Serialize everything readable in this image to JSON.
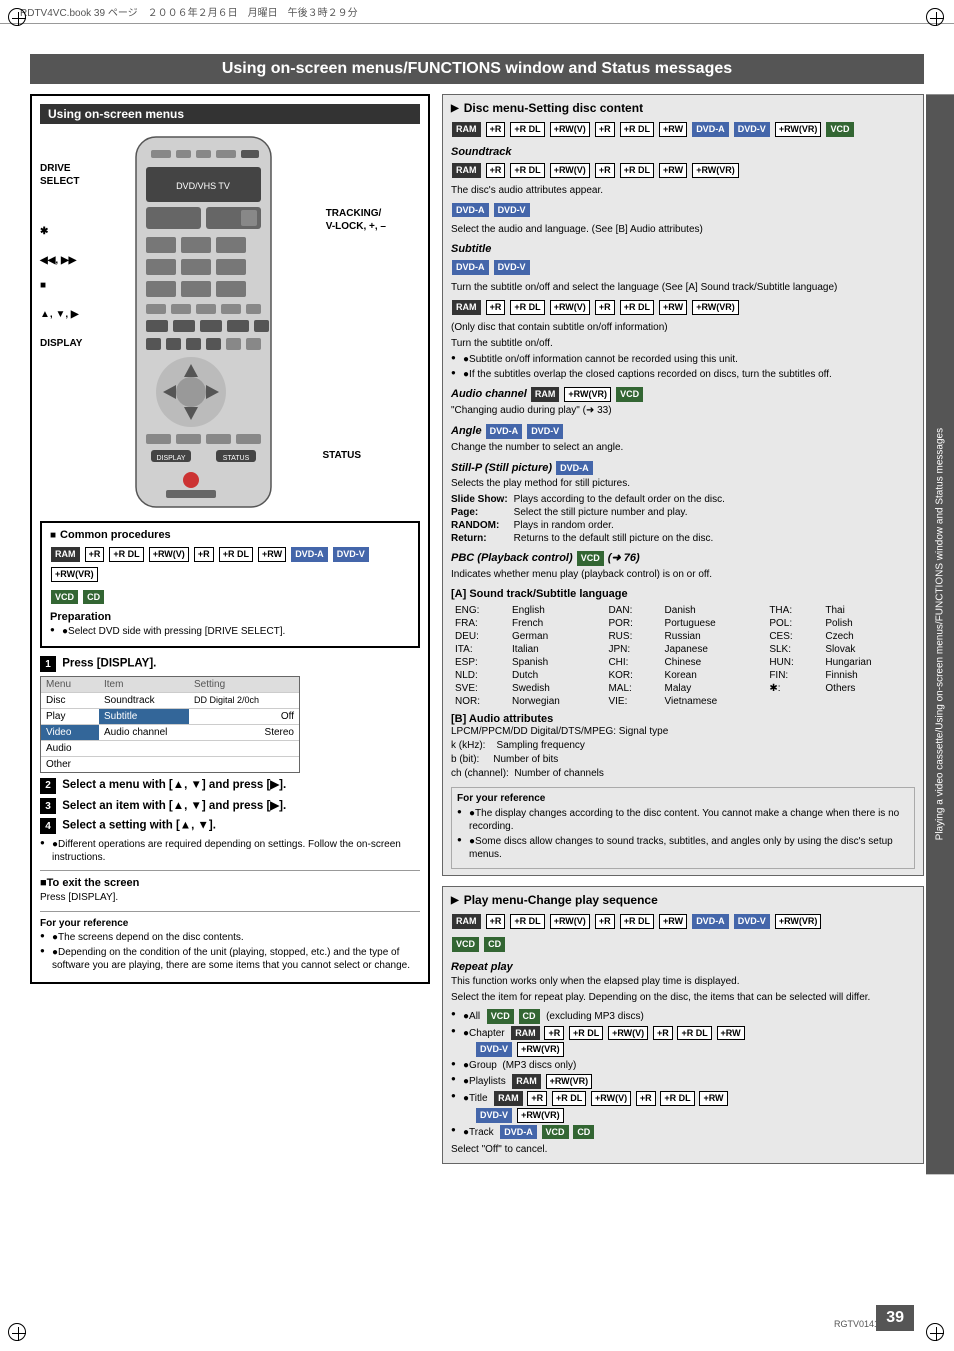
{
  "header": {
    "text": "RDTV4VC.book  39 ページ　２００６年２月６日　月曜日　午後３時２９分"
  },
  "title": "Using on-screen menus/FUNCTIONS window and Status messages",
  "left_section_title": "Using on-screen menus",
  "sidebar_text": "Playing a video cassette/Using on-screen menus/FUNCTIONS window and Status messages",
  "common_procedures": {
    "title": "Common procedures",
    "badges_line1": [
      "RAM",
      "+R",
      "+R DL",
      "+RW(V)",
      "+R",
      "+R DL",
      "+RW",
      "DVD-A",
      "DVD-V",
      "+RW(VR)"
    ],
    "badges_line2": [
      "VCD",
      "CD"
    ],
    "preparation_title": "Preparation",
    "preparation_text": "●Select DVD side with pressing [DRIVE SELECT].",
    "steps": [
      {
        "num": "1",
        "text": "Press [DISPLAY]."
      },
      {
        "num": "2",
        "text": "Select a menu with [▲, ▼] and press [▶]."
      },
      {
        "num": "3",
        "text": "Select an item with [▲, ▼] and press [▶]."
      },
      {
        "num": "4",
        "text": "Select a setting with [▲, ▼].",
        "bullet": "●Different operations are required depending on settings. Follow the on-screen instructions."
      }
    ],
    "exit_title": "■To exit the screen",
    "exit_text": "Press [DISPLAY].",
    "ref_title": "For your reference",
    "ref_bullets": [
      "●The screens depend on the disc contents.",
      "●Depending on the condition of the unit (playing, stopped, etc.) and the type of software you are playing, there are some items that you cannot select or change."
    ]
  },
  "menu_mockup": {
    "header_cols": [
      "Menu",
      "Item",
      "Setting"
    ],
    "rows": [
      {
        "col1": "Disc",
        "col2": "Soundtrack",
        "col3": "DD Digital 2/0ch",
        "active_col1": false,
        "active_col2": false
      },
      {
        "col1": "Play",
        "col2": "Subtitle",
        "col3": "Off",
        "active_col1": false,
        "active_col2": true
      },
      {
        "col1": "Video",
        "col2": "Audio channel",
        "col3": "Stereo",
        "active_col1": true,
        "active_col2": false
      },
      {
        "col1": "Audio",
        "col2": "",
        "col3": "",
        "active_col1": false,
        "active_col2": false
      },
      {
        "col1": "Other",
        "col2": "",
        "col3": "",
        "active_col1": false,
        "active_col2": false
      }
    ]
  },
  "remote_labels": {
    "drive_select": "DRIVE\nSELECT",
    "tracking": "TRACKING/\nV-LOCK, +, –",
    "star": "✱",
    "skip": "◀◀, ▶▶",
    "stop": "■",
    "arrows": "▲, ▼, ▶",
    "display": "DISPLAY",
    "status": "STATUS"
  },
  "right_sections": {
    "disc_menu": {
      "title": "Disc menu-Setting disc content",
      "badges": [
        "RAM",
        "+R",
        "+R DL",
        "+RW(V)",
        "+R",
        "+R DL",
        "+RW",
        "DVD-A",
        "DVD-V",
        "+RW(VR)",
        "VCD"
      ],
      "soundtrack": {
        "title": "Soundtrack",
        "badges": [
          "RAM",
          "+R",
          "+R DL",
          "+RW(V)",
          "+R",
          "+R DL",
          "+RW",
          "+RW(VR)"
        ],
        "text": "The disc's audio attributes appear.",
        "dvd_badges": [
          "DVD-A",
          "DVD-V"
        ],
        "dvd_text": "Select the audio and language. (See [B] Audio attributes)"
      },
      "subtitle": {
        "title": "Subtitle",
        "dvd_badges": [
          "DVD-A",
          "DVD-V"
        ],
        "dvd_text": "Turn the subtitle on/off and select the language (See [A] Sound track/Subtitle language)",
        "badges2": [
          "RAM",
          "+R",
          "+R DL",
          "+RW(V)",
          "+R",
          "+R DL",
          "+RW",
          "+RW(VR)"
        ],
        "note2": "(Only disc that contain subtitle on/off information)",
        "turn_text": "Turn the subtitle on/off.",
        "bullets": [
          "●Subtitle on/off information cannot be recorded using this unit.",
          "●If the subtitles overlap the closed captions recorded on discs, turn the subtitles off."
        ]
      },
      "audio_channel": {
        "title": "Audio channel",
        "badges": [
          "RAM",
          "+RW(VR)",
          "VCD"
        ],
        "text": "\"Changing audio during play\" (➜ 33)"
      },
      "angle": {
        "title": "Angle",
        "badges": [
          "DVD-A",
          "DVD-V"
        ],
        "text": "Change the number to select an angle."
      },
      "still_p": {
        "title": "Still-P (Still picture)",
        "badges": [
          "DVD-A"
        ],
        "text": "Selects the play method for still pictures.",
        "items": [
          {
            "label": "Slide Show:",
            "value": "Plays according to the default order on the disc."
          },
          {
            "label": "Page:",
            "value": "Select the still picture number and play."
          },
          {
            "label": "RANDOM:",
            "value": "Plays in random order."
          },
          {
            "label": "Return:",
            "value": "Returns to the default still picture on the disc."
          }
        ]
      },
      "pbc": {
        "title": "PBC (Playback control)",
        "badges": [
          "VCD"
        ],
        "arrow": "➜ 76",
        "text": "Indicates whether menu play (playback control) is on or off."
      }
    },
    "sound_track_subtitle": {
      "title": "[A] Sound track/Subtitle language",
      "languages": [
        {
          "code": "ENG:",
          "name": "English"
        },
        {
          "code": "FRA:",
          "name": "French"
        },
        {
          "code": "DEU:",
          "name": "German"
        },
        {
          "code": "ITA:",
          "name": "Italian"
        },
        {
          "code": "ESP:",
          "name": "Spanish"
        },
        {
          "code": "NLD:",
          "name": "Dutch"
        },
        {
          "code": "SVE:",
          "name": "Swedish"
        },
        {
          "code": "NOR:",
          "name": "Norwegian"
        }
      ],
      "languages2": [
        {
          "code": "DAN:",
          "name": "Danish"
        },
        {
          "code": "POR:",
          "name": "Portuguese"
        },
        {
          "code": "RUS:",
          "name": "Russian"
        },
        {
          "code": "JPN:",
          "name": "Japanese"
        },
        {
          "code": "CHI:",
          "name": "Chinese"
        },
        {
          "code": "KOR:",
          "name": "Korean"
        },
        {
          "code": "MAL:",
          "name": "Malay"
        },
        {
          "code": "VIE:",
          "name": "Vietnamese"
        }
      ],
      "languages3": [
        {
          "code": "THA:",
          "name": "Thai"
        },
        {
          "code": "POL:",
          "name": "Polish"
        },
        {
          "code": "CES:",
          "name": "Czech"
        },
        {
          "code": "SLK:",
          "name": "Slovak"
        },
        {
          "code": "HUN:",
          "name": "Hungarian"
        },
        {
          "code": "FIN:",
          "name": "Finnish"
        },
        {
          "code": "✱:",
          "name": "Others"
        }
      ]
    },
    "audio_attributes": {
      "title": "[B] Audio attributes",
      "items": [
        {
          "label": "LPCM/PPCM/DD Digital/DTS/MPEG: Signal type"
        },
        {
          "label": "k (kHz):",
          "value": "Sampling frequency"
        },
        {
          "label": "b (bit):",
          "value": "Number of bits"
        },
        {
          "label": "ch (channel):",
          "value": "Number of channels"
        }
      ]
    },
    "for_your_ref": {
      "title": "For your reference",
      "bullets": [
        "●The display changes according to the disc content. You cannot make a change when there is no recording.",
        "●Some discs allow changes to sound tracks, subtitles, and angles only by using the disc's setup menus."
      ]
    },
    "play_menu": {
      "title": "Play menu-Change play sequence",
      "badges": [
        "RAM",
        "+R",
        "+R DL",
        "+RW(V)",
        "+R",
        "+R DL",
        "+RW",
        "DVD-A",
        "DVD-V",
        "+RW(VR)",
        "VCD",
        "CD"
      ],
      "repeat_play": {
        "title": "Repeat play",
        "intro": "This function works only when the elapsed play time is displayed.",
        "intro2": "Select the item for repeat play. Depending on the disc, the items that can be selected will differ.",
        "items": [
          {
            "bullet": "●All",
            "badges": [
              "VCD",
              "CD"
            ],
            "note": "(excluding MP3 discs)"
          },
          {
            "bullet": "●Chapter",
            "badges": [
              "RAM",
              "+R",
              "+R DL",
              "+RW(V)",
              "+R",
              "+R DL",
              "+RW"
            ]
          },
          {
            "badges2": [
              "DVD-V",
              "+RW(VR)"
            ]
          },
          {
            "bullet": "●Group",
            "note": "(MP3 discs only)"
          },
          {
            "bullet": "●Playlists",
            "badges": [
              "RAM",
              "+RW(VR)"
            ]
          },
          {
            "bullet": "●Title",
            "badges": [
              "RAM",
              "+R",
              "+R DL",
              "+RW(V)",
              "+R",
              "+R DL",
              "+RW"
            ]
          },
          {
            "badges2": [
              "DVD-V",
              "+RW(VR)"
            ]
          },
          {
            "bullet": "●Track",
            "badges": [
              "DVD-A",
              "VCD",
              "CD"
            ]
          }
        ],
        "cancel_text": "Select \"Off\" to cancel."
      }
    }
  },
  "page_number": "39",
  "rgtv_label": "RGTV0141"
}
